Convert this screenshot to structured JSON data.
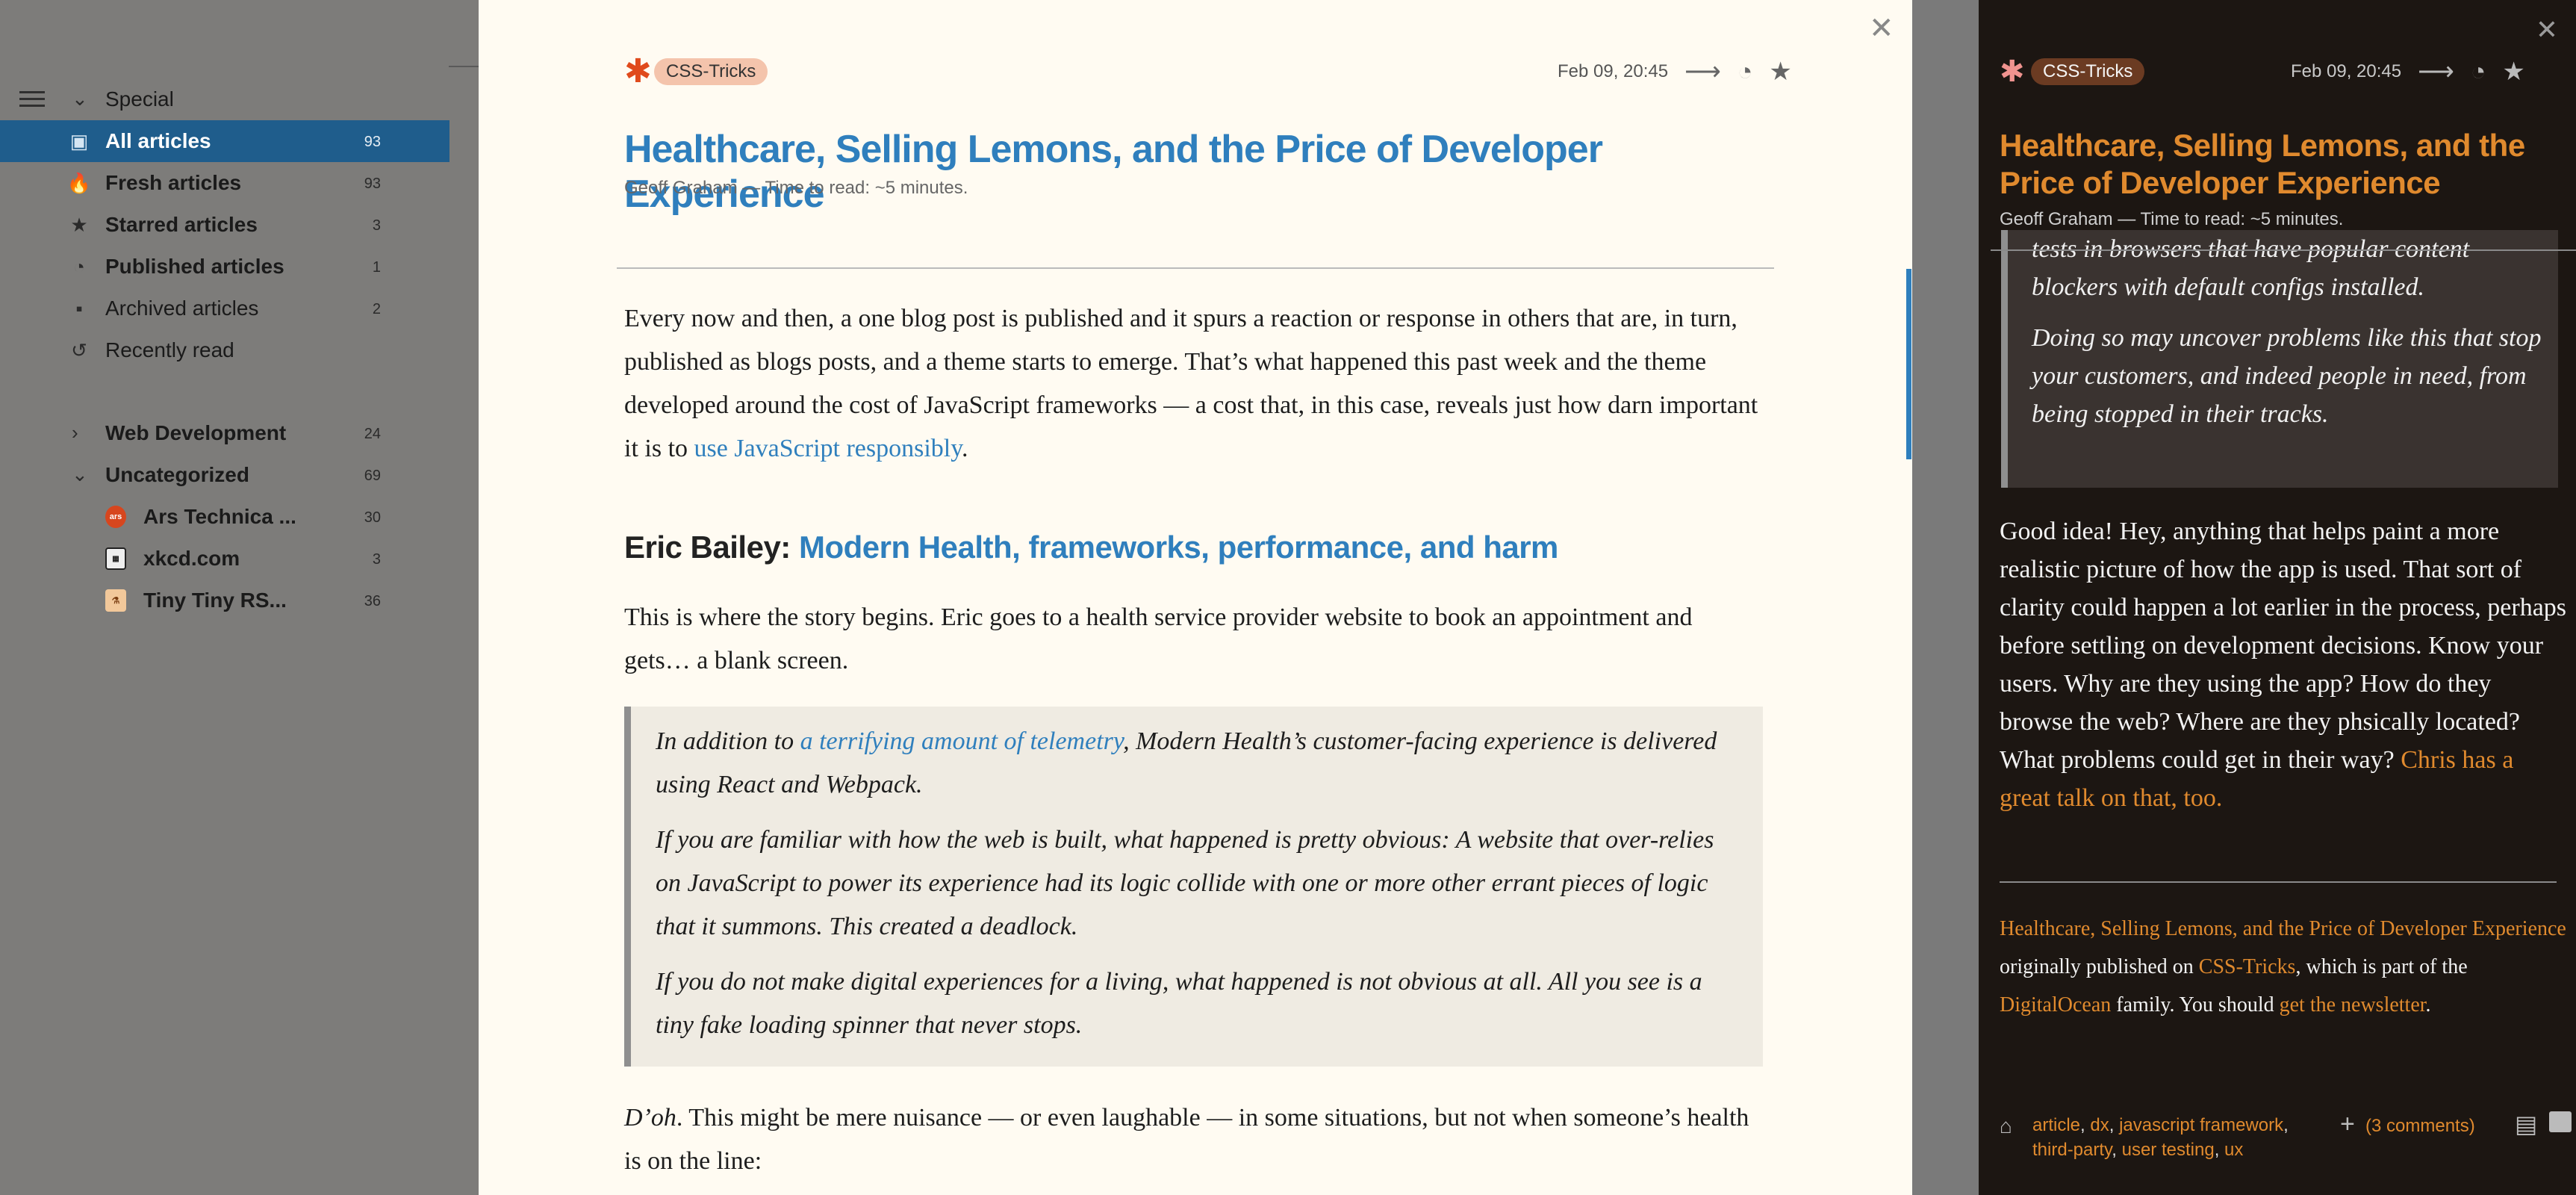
{
  "sidebar": {
    "special": {
      "label": "Special"
    },
    "items": [
      {
        "label": "All articles",
        "count": "93",
        "icon": "inbox-icon"
      },
      {
        "label": "Fresh articles",
        "count": "93",
        "icon": "fire-icon"
      },
      {
        "label": "Starred articles",
        "count": "3",
        "icon": "star-icon"
      },
      {
        "label": "Published articles",
        "count": "1",
        "icon": "rss-icon"
      },
      {
        "label": "Archived articles",
        "count": "2",
        "icon": "archive-icon"
      },
      {
        "label": "Recently read",
        "count": "",
        "icon": "history-icon"
      }
    ],
    "categories": [
      {
        "label": "Web Development",
        "count": "24"
      },
      {
        "label": "Uncategorized",
        "count": "69"
      }
    ],
    "feeds": [
      {
        "label": "Ars Technica ...",
        "count": "30",
        "favicon": "ars"
      },
      {
        "label": "xkcd.com",
        "count": "3",
        "favicon": "xkcd"
      },
      {
        "label": "Tiny Tiny RS...",
        "count": "36",
        "favicon": "tiny"
      }
    ]
  },
  "article": {
    "feed_tag": "CSS-Tricks",
    "date": "Feb 09, 20:45",
    "title": "Healthcare, Selling Lemons, and the Price of Developer Experience",
    "byline": "Geoff Graham — Time to read: ~5 minutes.",
    "p1_text": "Every now and then, a one blog post is published and it spurs a reaction or response in others that are, in turn, published as blogs posts, and a theme starts to emerge. That’s what happened this past week and the theme developed around the cost of JavaScript frameworks — a cost that, in this case, reveals just how darn important it is to ",
    "p1_link": "use JavaScript responsibly",
    "p1_end": ".",
    "h2_prefix": "Eric Bailey: ",
    "h2_link": "Modern Health, frameworks, performance, and harm",
    "p2": "This is where the story begins. Eric goes to a health service provider website to book an appointment and gets… a blank screen.",
    "bq1_start": "In addition to ",
    "bq1_link": "a terrifying amount of telemetry",
    "bq1_end": ", Modern Health’s customer-facing experience is delivered using React and Webpack.",
    "bq2": "If you are familiar with how the web is built, what happened is pretty obvious: A website that over-relies on JavaScript to power its experience had its logic collide with one or more other errant pieces of logic that it summons. This created a deadlock.",
    "bq3": "If you do not make digital experiences for a living, what happened is not obvious at all. All you see is a tiny fake loading spinner that never stops.",
    "p3_em": "D’oh",
    "p3_rest": ". This might be mere nuisance — or even laughable — in some situations, but not when someone’s health is on the line:"
  },
  "preview": {
    "feed_tag": "CSS-Tricks",
    "date": "Feb 09, 20:45",
    "title": "Healthcare, Selling Lemons, and the Price of Developer Experience",
    "byline": "Geoff Graham — Time to read: ~5 minutes.",
    "q0": "tests in browsers that have popular content blockers with default configs installed.",
    "q1": "Doing so may uncover problems like this that stop your customers, and indeed people in need, from being stopped in their tracks.",
    "body_text": "Good idea! Hey, anything that helps paint a more realistic picture of how the app is used. That sort of clarity could happen a lot earlier in the process, perhaps before settling on development decisions. Know your users. Why are they using the app? How do they browse the web? Where are they phsically located? What problems could get in their way? ",
    "body_link": "Chris has a great talk on that, too.",
    "foot_link1": "Healthcare, Selling Lemons, and the Price of Developer Experience",
    "foot_t1": " originally published on ",
    "foot_link2": "CSS-Tricks",
    "foot_t2": ", which is part of the ",
    "foot_link3": "DigitalOcean",
    "foot_t3": " family. You should ",
    "foot_link4": "get the newsletter",
    "foot_t4": ".",
    "tags": [
      "article",
      "dx",
      "javascript framework",
      "third-party",
      "user testing",
      "ux"
    ],
    "comments": "(3 comments)"
  },
  "colors": {
    "accent_blue": "#2f7fbd",
    "accent_orange": "#e08a2e",
    "selected_row": "#1f5d8c"
  }
}
